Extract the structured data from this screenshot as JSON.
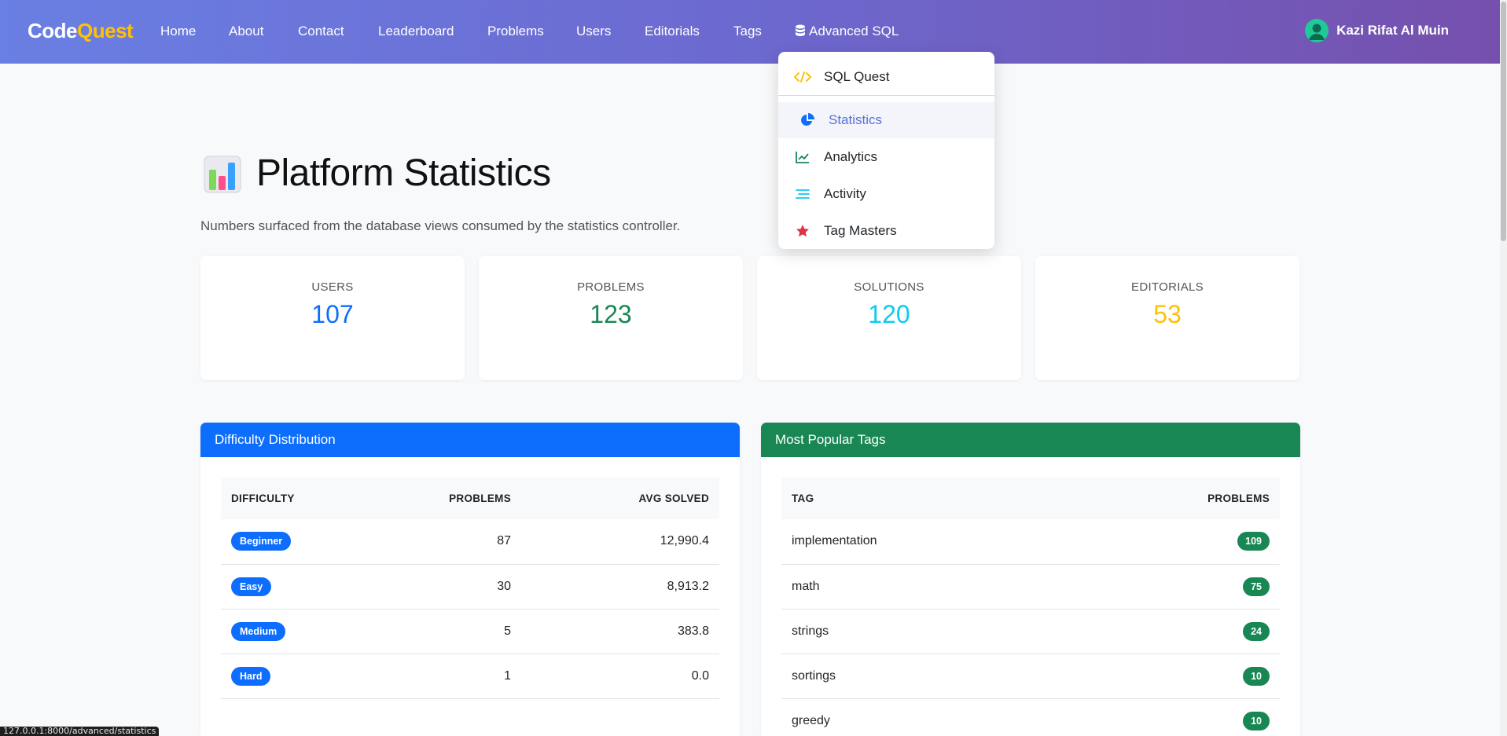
{
  "navbar": {
    "brand_main": "Code",
    "brand_accent": "Quest",
    "links": [
      "Home",
      "About",
      "Contact",
      "Leaderboard",
      "Problems",
      "Users",
      "Editorials",
      "Tags"
    ],
    "advanced_label": "Advanced SQL",
    "user_name": "Kazi Rifat Al Muin"
  },
  "dropdown": {
    "items": [
      {
        "label": "SQL Quest",
        "icon": "code-icon",
        "color": "#ffc107"
      },
      {
        "label": "Statistics",
        "icon": "pie-chart-icon",
        "color": "#0d6efd"
      },
      {
        "label": "Analytics",
        "icon": "line-chart-icon",
        "color": "#198754"
      },
      {
        "label": "Activity",
        "icon": "list-icon",
        "color": "#0dcaf0"
      },
      {
        "label": "Tag Masters",
        "icon": "star-icon",
        "color": "#dc3545"
      }
    ]
  },
  "page": {
    "title": "Platform Statistics",
    "subtitle": "Numbers surfaced from the database views consumed by the statistics controller."
  },
  "stats": [
    {
      "label": "USERS",
      "value": "107",
      "color": "#0d6efd"
    },
    {
      "label": "PROBLEMS",
      "value": "123",
      "color": "#198754"
    },
    {
      "label": "SOLUTIONS",
      "value": "120",
      "color": "#0dcaf0"
    },
    {
      "label": "EDITORIALS",
      "value": "53",
      "color": "#ffc107"
    }
  ],
  "difficulty": {
    "title": "Difficulty Distribution",
    "color": "#0d6efd",
    "headers": [
      "DIFFICULTY",
      "PROBLEMS",
      "AVG SOLVED"
    ],
    "rows": [
      {
        "level": "Beginner",
        "problems": "87",
        "avg": "12,990.4"
      },
      {
        "level": "Easy",
        "problems": "30",
        "avg": "8,913.2"
      },
      {
        "level": "Medium",
        "problems": "5",
        "avg": "383.8"
      },
      {
        "level": "Hard",
        "problems": "1",
        "avg": "0.0"
      }
    ]
  },
  "tags": {
    "title": "Most Popular Tags",
    "color": "#198754",
    "headers": [
      "TAG",
      "PROBLEMS"
    ],
    "rows": [
      {
        "tag": "implementation",
        "count": "109"
      },
      {
        "tag": "math",
        "count": "75"
      },
      {
        "tag": "strings",
        "count": "24"
      },
      {
        "tag": "sortings",
        "count": "10"
      },
      {
        "tag": "greedy",
        "count": "10"
      }
    ]
  },
  "status_url": "127.0.0.1:8000/advanced/statistics"
}
